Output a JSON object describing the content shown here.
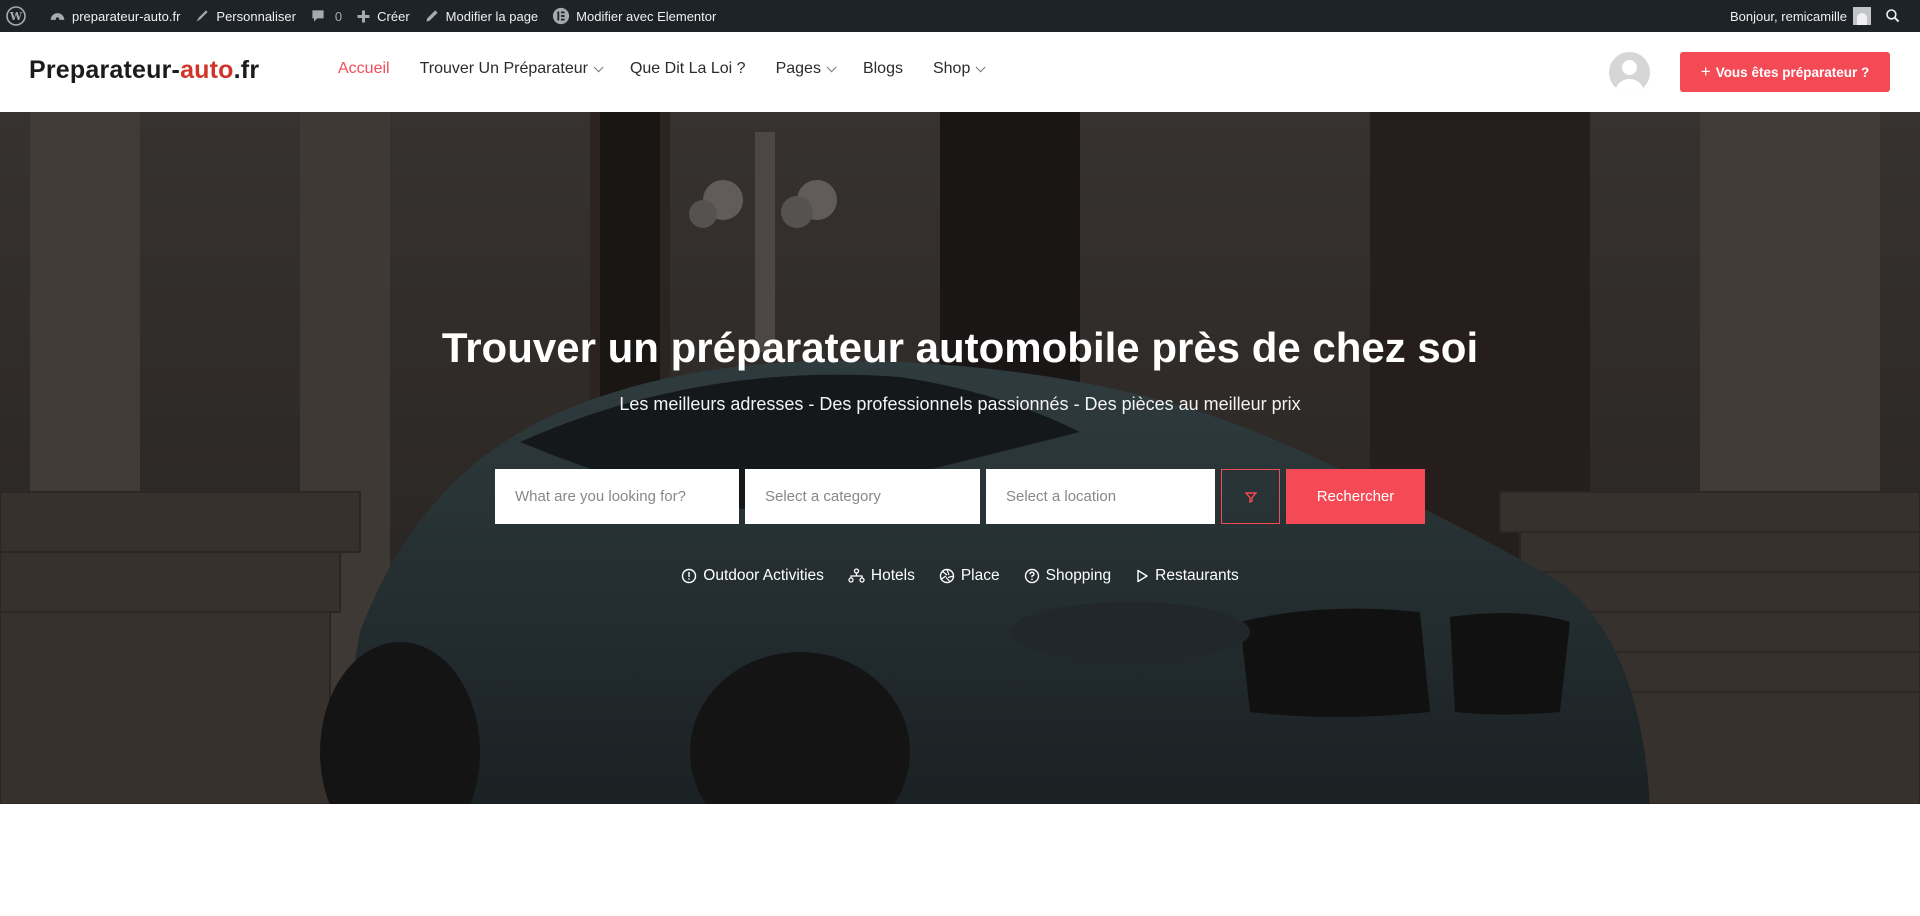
{
  "adminbar": {
    "site_name": "preparateur-auto.fr",
    "customize": "Personnaliser",
    "comments_count": "0",
    "new": "Créer",
    "edit_page": "Modifier la page",
    "edit_elementor": "Modifier avec Elementor",
    "greeting": "Bonjour, remicamille"
  },
  "header": {
    "logo_part1": "Preparateur-",
    "logo_accent": "auto",
    "logo_part3": ".fr",
    "nav": [
      {
        "label": "Accueil",
        "active": true,
        "dropdown": false
      },
      {
        "label": "Trouver Un Préparateur",
        "active": false,
        "dropdown": true
      },
      {
        "label": "Que Dit La Loi ?",
        "active": false,
        "dropdown": false
      },
      {
        "label": "Pages",
        "active": false,
        "dropdown": true
      },
      {
        "label": "Blogs",
        "active": false,
        "dropdown": false
      },
      {
        "label": "Shop",
        "active": false,
        "dropdown": true
      }
    ],
    "cta_label": "Vous êtes préparateur ?"
  },
  "hero": {
    "title": "Trouver un préparateur automobile près de chez soi",
    "subtitle": "Les meilleurs adresses - Des professionnels passionnés - Des pièces au meilleur prix",
    "search": {
      "what_placeholder": "What are you looking for?",
      "category_placeholder": "Select a category",
      "location_placeholder": "Select a location",
      "button": "Rechercher"
    },
    "categories": [
      {
        "label": "Outdoor Activities",
        "icon": "info-circle-icon"
      },
      {
        "label": "Hotels",
        "icon": "network-icon"
      },
      {
        "label": "Place",
        "icon": "aperture-icon"
      },
      {
        "label": "Shopping",
        "icon": "question-circle-icon"
      },
      {
        "label": "Restaurants",
        "icon": "play-icon"
      }
    ]
  },
  "colors": {
    "accent": "#f44a56",
    "adminbar_bg": "#1d2327",
    "logo_accent": "#d0352b"
  }
}
